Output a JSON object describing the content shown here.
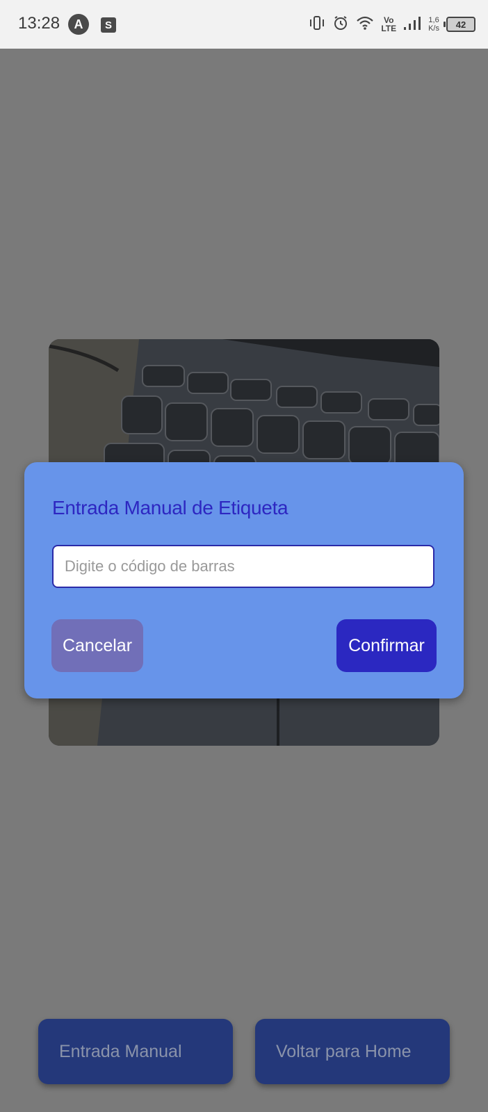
{
  "status_bar": {
    "time": "13:28",
    "app_icon_letter": "A",
    "shop_icon_letter": "S",
    "volte_top": "Vo",
    "volte_bottom": "LTE",
    "net_speed_value": "1,6",
    "net_speed_unit": "K/s",
    "battery": "42"
  },
  "dialog": {
    "title": "Entrada Manual de Etiqueta",
    "input_placeholder": "Digite o código de barras",
    "input_value": "",
    "cancel_label": "Cancelar",
    "confirm_label": "Confirmar"
  },
  "bottom_actions": {
    "manual_entry_label": "Entrada Manual",
    "home_label": "Voltar para Home"
  },
  "colors": {
    "dialog_bg": "#6794ea",
    "title": "#2d27c1",
    "confirm_bg": "#2b28c1",
    "cancel_bg": "#716fb8",
    "bottom_button_bg": "#24387a",
    "page_dim": "#7a7a7a"
  }
}
